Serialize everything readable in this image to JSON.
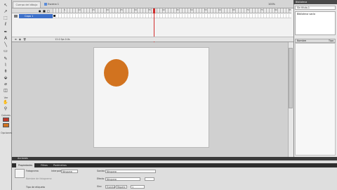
{
  "document": {
    "tab_label": "Cuerpo del dibujo",
    "scene_label": "Escena 1",
    "zoom": "100%"
  },
  "tools": {
    "items": [
      {
        "name": "selection-tool",
        "glyph": "↖"
      },
      {
        "name": "subselection-tool",
        "glyph": "↗"
      },
      {
        "name": "free-transform-tool",
        "glyph": "⬚"
      },
      {
        "name": "lasso-tool",
        "glyph": "ℓ"
      },
      {
        "name": "pen-tool",
        "glyph": "✒"
      },
      {
        "name": "text-tool",
        "glyph": "A"
      },
      {
        "name": "line-tool",
        "glyph": "╲"
      },
      {
        "name": "rectangle-tool",
        "glyph": "▭"
      },
      {
        "name": "pencil-tool",
        "glyph": "✎"
      },
      {
        "name": "brush-tool",
        "glyph": "⌇"
      },
      {
        "name": "ink-bottle-tool",
        "glyph": "⚱"
      },
      {
        "name": "paint-bucket-tool",
        "glyph": "⬙"
      },
      {
        "name": "eyedropper-tool",
        "glyph": "⌀"
      },
      {
        "name": "eraser-tool",
        "glyph": "◫"
      }
    ],
    "view_section": "Ver",
    "view_tools": [
      {
        "name": "hand-tool",
        "glyph": "✋"
      },
      {
        "name": "zoom-tool",
        "glyph": "⚲"
      }
    ],
    "colors_section": "Colores",
    "options_section": "Opciones"
  },
  "timeline": {
    "layer_name": "Capa 1",
    "ruler_labels": [
      "5",
      "10",
      "15",
      "20",
      "25",
      "30",
      "35",
      "40",
      "45",
      "50",
      "55",
      "60",
      "65",
      "70",
      "75",
      "80",
      "85"
    ],
    "footer": "12.0 fps   0.0s"
  },
  "stage": {
    "shape_color": "#d2731f"
  },
  "right_panel": {
    "title": "Biblioteca",
    "select_value": "Sin título-1",
    "list_text": "Biblioteca vacía",
    "head_left": "Nombre",
    "head_right": "Tipo"
  },
  "properties": {
    "bar_title": "Acciones",
    "tabs": [
      "Propiedades",
      "Filtros",
      "Parámetros"
    ],
    "tween_label": "Interpolación",
    "tween_value": "Ninguna",
    "sound_label": "Sonido",
    "sound_value": "Ninguno",
    "effect_label": "Efecto",
    "effect_value": "Ninguno",
    "sync_label": "Sinc",
    "sync_value": "Evento",
    "sync_repeat": "Repetir",
    "sync_count": "1",
    "frame_label": "Fotograma",
    "frame_name_label": "Nombre de fotograma",
    "label_type": "Tipo de etiqueta"
  }
}
